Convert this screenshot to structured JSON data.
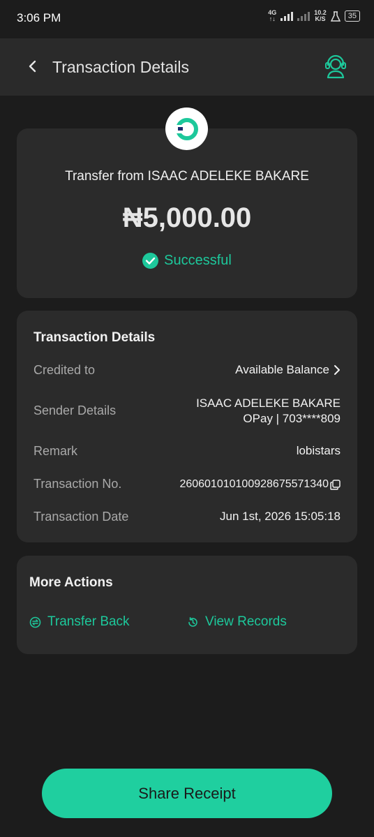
{
  "status_bar": {
    "time": "3:06 PM",
    "network_type": "4G",
    "speed_value": "10.2",
    "speed_unit": "K/S",
    "battery": "35"
  },
  "header": {
    "title": "Transaction Details"
  },
  "summary": {
    "transfer_from": "Transfer from ISAAC ADELEKE BAKARE",
    "amount": "₦5,000.00",
    "status": "Successful"
  },
  "details": {
    "section_title": "Transaction Details",
    "credited_to_label": "Credited to",
    "credited_to_value": "Available Balance",
    "sender_label": "Sender Details",
    "sender_name": "ISAAC ADELEKE BAKARE",
    "sender_account": "OPay | 703****809",
    "remark_label": "Remark",
    "remark_value": "lobistars",
    "txn_no_label": "Transaction No.",
    "txn_no_value": "260601010100928675571340",
    "txn_date_label": "Transaction Date",
    "txn_date_value": "Jun 1st, 2026 15:05:18"
  },
  "more_actions": {
    "title": "More Actions",
    "transfer_back": "Transfer Back",
    "view_records": "View Records"
  },
  "share_button": "Share Receipt",
  "colors": {
    "accent": "#1dc89b",
    "background": "#1c1c1c",
    "card": "#2b2b2b",
    "header": "#2a2a2a"
  },
  "icons": [
    "back-arrow-icon",
    "support-headset-icon",
    "opay-logo",
    "check-circle-icon",
    "chevron-right-icon",
    "copy-icon",
    "transfer-back-icon",
    "history-icon"
  ]
}
